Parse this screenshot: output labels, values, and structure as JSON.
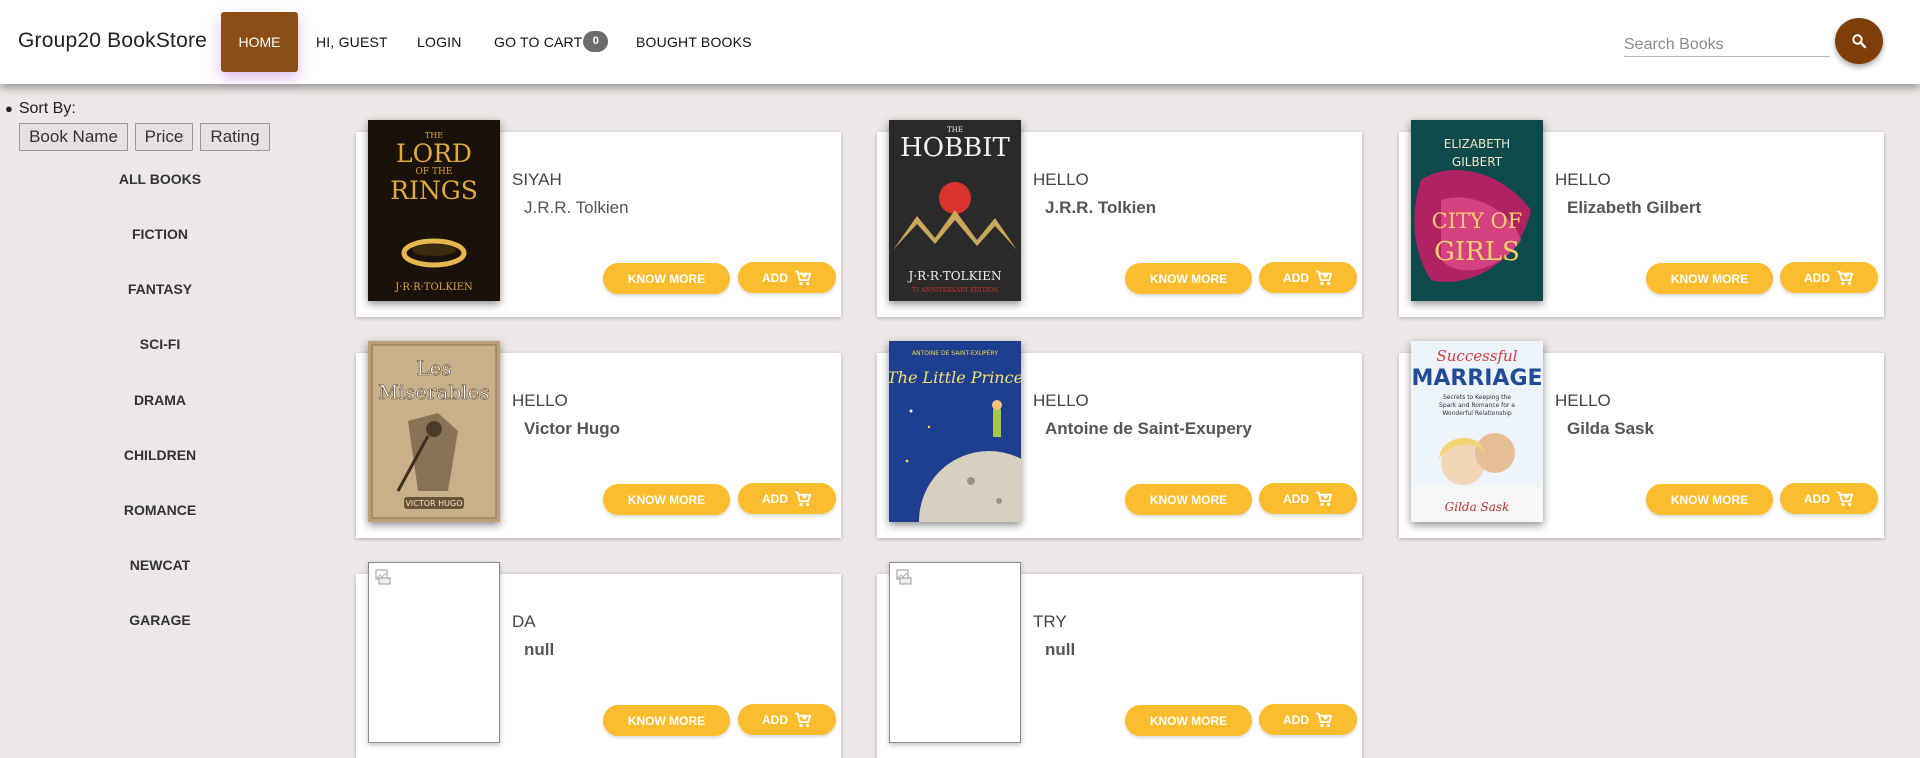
{
  "navbar": {
    "brand": "Group20 BookStore",
    "home": "HOME",
    "greeting": "HI, GUEST",
    "login": "LOGIN",
    "cart": "GO TO CART",
    "cart_count": "0",
    "bought": "BOUGHT BOOKS",
    "search_placeholder": "Search Books",
    "search_icon": "search-icon"
  },
  "sidebar": {
    "sort_label": "Sort By:",
    "sort_buttons": [
      "Book Name",
      "Price",
      "Rating"
    ],
    "categories": [
      "ALL BOOKS",
      "FICTION",
      "FANTASY",
      "SCI-FI",
      "DRAMA",
      "CHILDREN",
      "ROMANCE",
      "NEWCAT",
      "GARAGE"
    ]
  },
  "books": [
    {
      "title": "SIYAH",
      "author": "J.R.R. Tolkien",
      "cover_title": "THE LORD OF THE RINGS",
      "cover_author": "J·R·R·TOLKIEN"
    },
    {
      "title": "HELLO",
      "author": "J.R.R. Tolkien",
      "cover_title": "THE HOBBIT",
      "cover_author": "J·R·R·TOLKIEN"
    },
    {
      "title": "HELLO",
      "author": "Elizabeth Gilbert",
      "cover_title": "CITY OF GIRLS",
      "cover_author": "ELIZABETH GILBERT"
    },
    {
      "title": "HELLO",
      "author": "Victor Hugo",
      "cover_title": "Les Miserables",
      "cover_author": "VICTOR HUGO"
    },
    {
      "title": "HELLO",
      "author": "Antoine de Saint-Exupery",
      "cover_title": "The Little Prince",
      "cover_author": "ANTOINE DE SAINT-EXUPÉRY"
    },
    {
      "title": "HELLO",
      "author": "Gilda Sask",
      "cover_title": "Successful MARRIAGE",
      "cover_author": "Gilda Sask"
    },
    {
      "title": "DA",
      "author": "null"
    },
    {
      "title": "TRY",
      "author": "null"
    }
  ],
  "card_buttons": {
    "know_more": "KNOW MORE",
    "add": "ADD"
  },
  "colors": {
    "accent": "#fbbc2d",
    "home": "#8b4e16",
    "search": "#7e3e08",
    "background": "#ece8e7"
  }
}
